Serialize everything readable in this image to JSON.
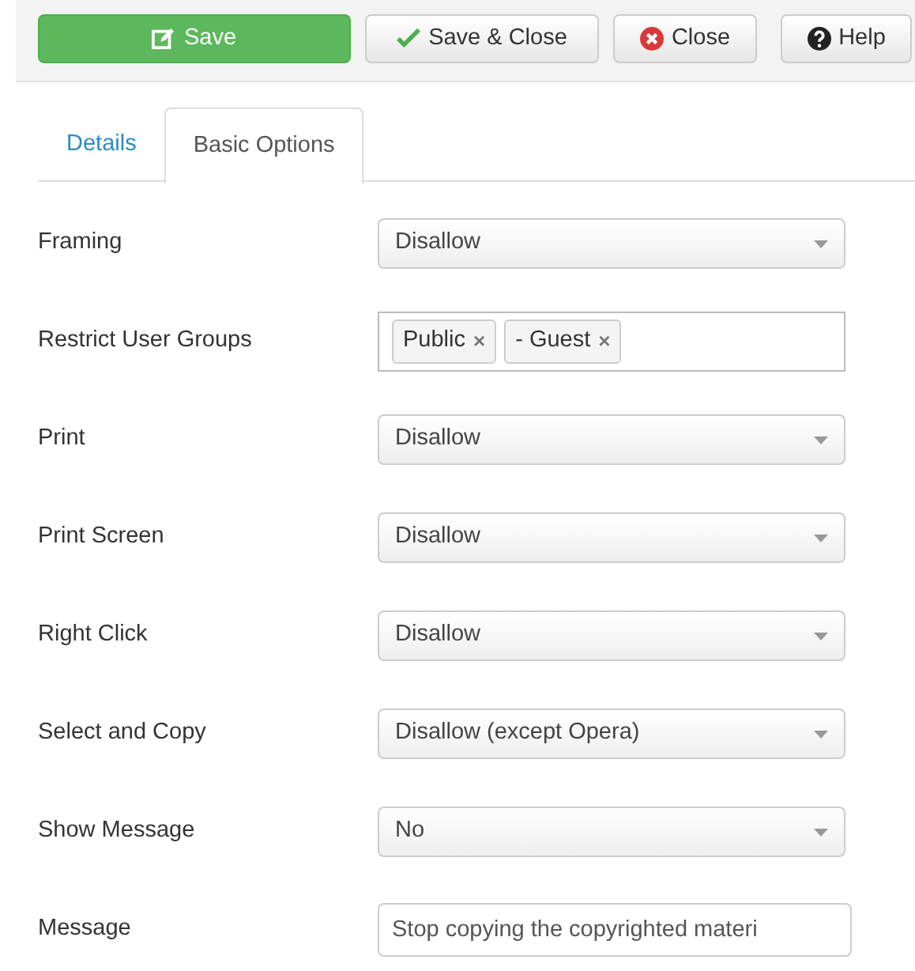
{
  "toolbar": [
    {
      "kind": "save",
      "label": "Save"
    },
    {
      "kind": "save-close",
      "label": "Save & Close"
    },
    {
      "kind": "close",
      "label": "Close"
    },
    {
      "kind": "help",
      "label": "Help"
    }
  ],
  "tabs": [
    {
      "label": "Details",
      "selected": false
    },
    {
      "label": "Basic Options",
      "selected": true
    }
  ],
  "fields": [
    {
      "label": "Framing",
      "kind": "select",
      "value": "Disallow"
    },
    {
      "label": "Restrict User Groups",
      "kind": "tags",
      "tags": [
        "Public",
        "- Guest"
      ],
      "remove_mark": "×"
    },
    {
      "label": "Print",
      "kind": "select",
      "value": "Disallow"
    },
    {
      "label": "Print Screen",
      "kind": "select",
      "value": "Disallow"
    },
    {
      "label": "Right Click",
      "kind": "select",
      "value": "Disallow"
    },
    {
      "label": "Select and Copy",
      "kind": "select",
      "value": "Disallow (except Opera)"
    },
    {
      "label": "Show Message",
      "kind": "select",
      "value": "No"
    },
    {
      "label": "Message",
      "kind": "text",
      "value": "Stop copying the copyrighted materi"
    }
  ]
}
